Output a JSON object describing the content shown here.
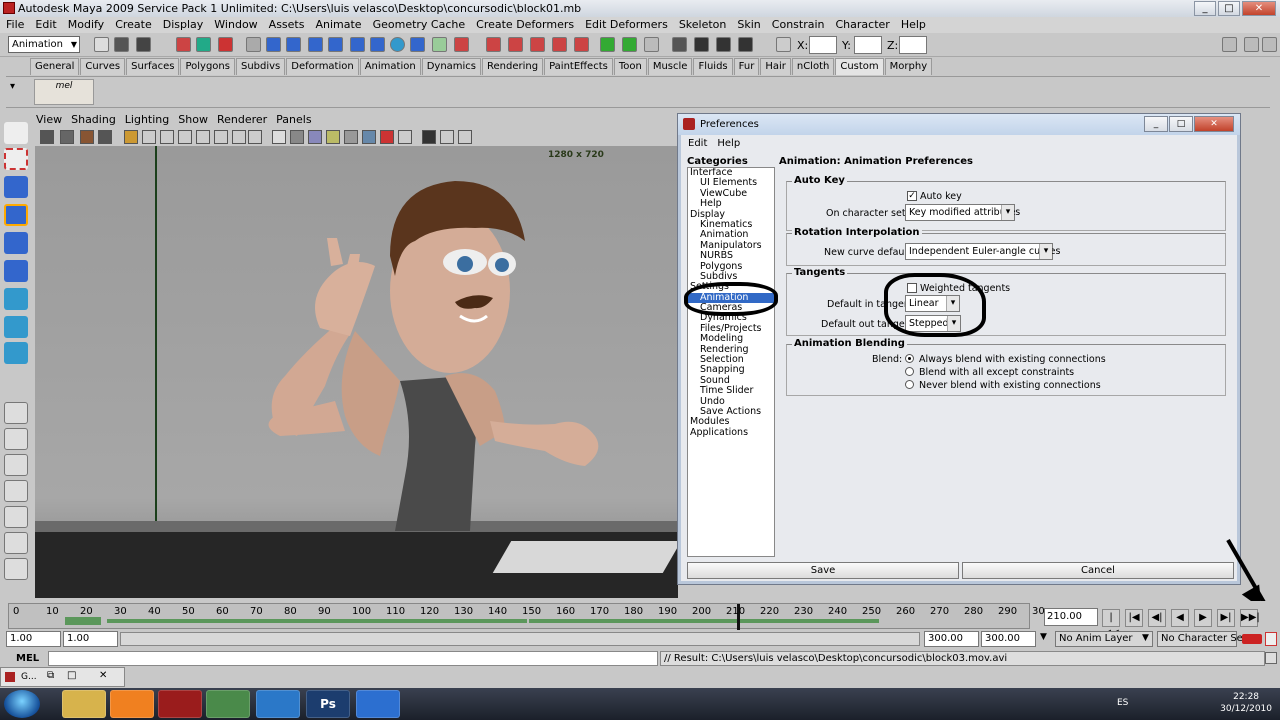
{
  "window": {
    "title": "Autodesk Maya 2009 Service Pack 1 Unlimited: C:\\Users\\luis velasco\\Desktop\\concursodic\\block01.mb",
    "minimize": "_",
    "maximize": "□",
    "close": "✕"
  },
  "menubar": [
    "File",
    "Edit",
    "Modify",
    "Create",
    "Display",
    "Window",
    "Assets",
    "Animate",
    "Geometry Cache",
    "Create Deformers",
    "Edit Deformers",
    "Skeleton",
    "Skin",
    "Constrain",
    "Character",
    "Help"
  ],
  "statusline": {
    "mode": "Animation",
    "x_label": "X:",
    "y_label": "Y:",
    "z_label": "Z:"
  },
  "shelf": {
    "tabs": [
      "General",
      "Curves",
      "Surfaces",
      "Polygons",
      "Subdivs",
      "Deformation",
      "Animation",
      "Dynamics",
      "Rendering",
      "PaintEffects",
      "Toon",
      "Muscle",
      "Fluids",
      "Fur",
      "Hair",
      "nCloth",
      "Custom",
      "Morphy"
    ],
    "active_tab": "Custom",
    "mel_icon": "mel"
  },
  "panel": {
    "menus": [
      "View",
      "Shading",
      "Lighting",
      "Show",
      "Renderer",
      "Panels"
    ],
    "resolution": "1280 x 720"
  },
  "timeline": {
    "ticks": [
      "10",
      "20",
      "30",
      "40",
      "50",
      "60",
      "70",
      "80",
      "90",
      "100",
      "110",
      "120",
      "130",
      "140",
      "150",
      "160",
      "170",
      "180",
      "190",
      "200",
      "210",
      "220",
      "230",
      "240",
      "250",
      "260",
      "270",
      "280",
      "290",
      "30"
    ],
    "first_tick": "0",
    "current_frame": "210.00",
    "playback": [
      "|◀◀",
      "|◀",
      "◀|",
      "◀",
      "▶",
      "▶|",
      "▶▶|"
    ]
  },
  "range": {
    "start": "1.00",
    "playback_start": "1.00",
    "playback_end": "300.00",
    "end": "300.00",
    "anim_layer": "No Anim Layer",
    "character_set": "No Character Set"
  },
  "command": {
    "mel_label": "MEL",
    "result": "// Result: C:\\Users\\luis velasco\\Desktop\\concursodic\\block03.mov.avi"
  },
  "minitask": {
    "label": "G..."
  },
  "taskbar": {
    "ps_label": "Ps",
    "lang": "ES",
    "time": "22:28",
    "date": "30/12/2010"
  },
  "prefs": {
    "title": "Preferences",
    "menu": [
      "Edit",
      "Help"
    ],
    "categories_label": "Categories",
    "categories": [
      {
        "label": "Interface",
        "level": 0
      },
      {
        "label": "UI Elements",
        "level": 1
      },
      {
        "label": "ViewCube",
        "level": 1
      },
      {
        "label": "Help",
        "level": 1
      },
      {
        "label": "Display",
        "level": 0
      },
      {
        "label": "Kinematics",
        "level": 1
      },
      {
        "label": "Animation",
        "level": 1
      },
      {
        "label": "Manipulators",
        "level": 1
      },
      {
        "label": "NURBS",
        "level": 1
      },
      {
        "label": "Polygons",
        "level": 1
      },
      {
        "label": "Subdivs",
        "level": 1
      },
      {
        "label": "Settings",
        "level": 0
      },
      {
        "label": "Animation",
        "level": 1,
        "selected": true
      },
      {
        "label": "Cameras",
        "level": 1
      },
      {
        "label": "Dynamics",
        "level": 1
      },
      {
        "label": "Files/Projects",
        "level": 1
      },
      {
        "label": "Modeling",
        "level": 1
      },
      {
        "label": "Rendering",
        "level": 1
      },
      {
        "label": "Selection",
        "level": 1
      },
      {
        "label": "Snapping",
        "level": 1
      },
      {
        "label": "Sound",
        "level": 1
      },
      {
        "label": "Time Slider",
        "level": 1
      },
      {
        "label": "Undo",
        "level": 1
      },
      {
        "label": "Save Actions",
        "level": 1
      },
      {
        "label": "Modules",
        "level": 0
      },
      {
        "label": "Applications",
        "level": 0
      }
    ],
    "page_title": "Animation: Animation Preferences",
    "autokey": {
      "group": "Auto Key",
      "checkbox_label": "Auto key",
      "checked": true,
      "charsets_label": "On character sets:",
      "charsets_value": "Key modified attributes"
    },
    "rotation": {
      "group": "Rotation Interpolation",
      "label": "New curve default:",
      "value": "Independent Euler-angle curves"
    },
    "tangents": {
      "group": "Tangents",
      "weighted_label": "Weighted tangents",
      "weighted_checked": false,
      "in_label": "Default in tangent:",
      "in_value": "Linear",
      "out_label": "Default out tangent:",
      "out_value": "Stepped"
    },
    "blending": {
      "group": "Animation Blending",
      "label": "Blend:",
      "options": [
        "Always blend with existing connections",
        "Blend with all except constraints",
        "Never blend with existing connections"
      ],
      "selected_index": 0
    },
    "save": "Save",
    "cancel": "Cancel"
  },
  "colors": {
    "selection": "#3169c6",
    "maya_red": "#b22222",
    "timeline_wave": "#3a8a3a"
  }
}
